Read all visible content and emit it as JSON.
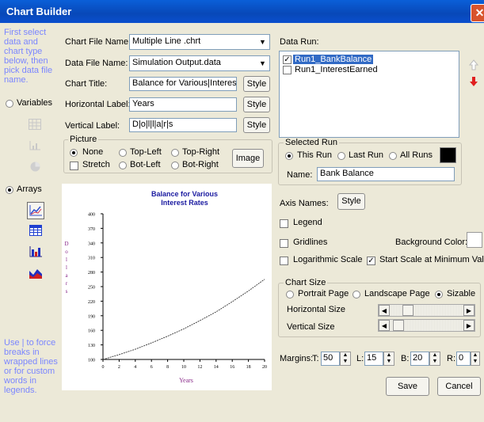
{
  "window": {
    "title": "Chart Builder"
  },
  "help": {
    "select": "First select data and chart type below, then pick data file name.",
    "breaks": "Use | to force breaks in wrapped lines or for custom words in legends."
  },
  "left": {
    "variables_label": "Variables",
    "arrays_label": "Arrays",
    "mode": "Arrays"
  },
  "form": {
    "chart_file_label": "Chart File Name:",
    "chart_file_value": "Multiple Line .chrt",
    "data_file_label": "Data File Name:",
    "data_file_value": "Simulation Output.data",
    "chart_title_label": "Chart Title:",
    "chart_title_value": "Balance for Various|Interest",
    "horizontal_label": "Horizontal Label:",
    "horizontal_value": "Years",
    "vertical_label": "Vertical Label:",
    "vertical_value": "D|o|l|l|a|r|s",
    "style_label": "Style"
  },
  "picture": {
    "title": "Picture",
    "none": "None",
    "top_left": "Top-Left",
    "top_right": "Top-Right",
    "stretch": "Stretch",
    "bot_left": "Bot-Left",
    "bot_right": "Bot-Right",
    "selected": "None",
    "image_button": "Image"
  },
  "data_run": {
    "label": "Data Run:",
    "items": [
      {
        "label": "Run1_BankBalance",
        "checked": true,
        "selected": true
      },
      {
        "label": "Run1_InterestEarned",
        "checked": false,
        "selected": false
      }
    ]
  },
  "selected_run": {
    "title": "Selected Run",
    "this_run": "This Run",
    "last_run": "Last Run",
    "all_runs": "All Runs",
    "selected": "This Run",
    "color": "#000000",
    "name_label": "Name:",
    "name_value": "Bank Balance"
  },
  "axis": {
    "axis_names_label": "Axis Names:",
    "style_label": "Style"
  },
  "options": {
    "legend": "Legend",
    "legend_checked": false,
    "gridlines": "Gridlines",
    "gridlines_checked": false,
    "background_color_label": "Background Color:",
    "background_color": "#ffffff",
    "log_scale": "Logarithmic Scale",
    "log_scale_checked": false,
    "start_min": "Start Scale at Minimum Value",
    "start_min_checked": true
  },
  "chart_size": {
    "title": "Chart Size",
    "portrait": "Portrait Page",
    "landscape": "Landscape Page",
    "sizable": "Sizable",
    "selected": "Sizable",
    "horizontal_size_label": "Horizontal Size",
    "vertical_size_label": "Vertical Size",
    "horizontal_size": 0.2,
    "vertical_size": 0.05
  },
  "margins": {
    "label": "Margins:",
    "t_label": "T:",
    "t": "50",
    "l_label": "L:",
    "l": "15",
    "b_label": "B:",
    "b": "20",
    "r_label": "R:",
    "r": "0"
  },
  "buttons": {
    "save": "Save",
    "cancel": "Cancel"
  },
  "chart_data": {
    "type": "line",
    "title": "Balance for Various Interest Rates",
    "xlabel": "Years",
    "ylabel": "Dollars",
    "xlim": [
      0,
      20
    ],
    "ylim": [
      100,
      400
    ],
    "xticks": [
      "0",
      "2",
      "4",
      "6",
      "8",
      "10",
      "12",
      "14",
      "16",
      "18",
      "20"
    ],
    "yticks": [
      "100",
      "130",
      "160",
      "190",
      "220",
      "250",
      "280",
      "310",
      "340",
      "370",
      "400"
    ],
    "series": [
      {
        "name": "Bank Balance",
        "x": [
          0,
          2,
          4,
          6,
          8,
          10,
          12,
          14,
          16,
          18,
          20
        ],
        "values": [
          100,
          110,
          121,
          134,
          148,
          163,
          180,
          198,
          219,
          241,
          265
        ]
      }
    ],
    "grid": false,
    "legend": "none"
  }
}
